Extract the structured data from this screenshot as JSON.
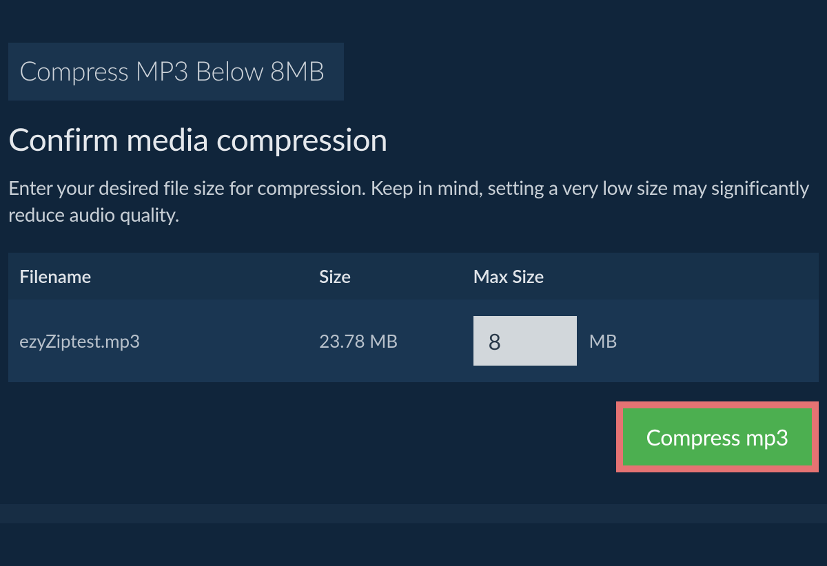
{
  "tab": {
    "label": "Compress MP3 Below 8MB"
  },
  "heading": "Confirm media compression",
  "description": "Enter your desired file size for compression. Keep in mind, setting a very low size may significantly reduce audio quality.",
  "table": {
    "headers": {
      "filename": "Filename",
      "size": "Size",
      "maxsize": "Max Size"
    },
    "rows": [
      {
        "filename": "ezyZiptest.mp3",
        "size": "23.78 MB",
        "maxsize_value": "8",
        "maxsize_unit": "MB"
      }
    ]
  },
  "actions": {
    "compress_label": "Compress mp3"
  }
}
